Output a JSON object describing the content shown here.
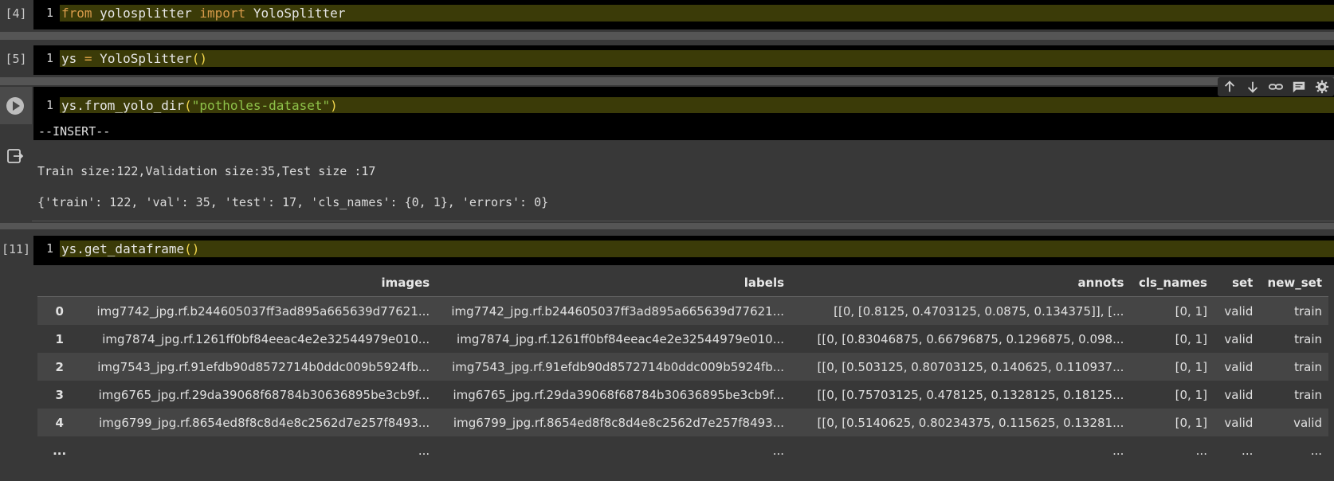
{
  "cells": {
    "c4": {
      "prompt": "[4]",
      "line": "1",
      "kw1": "from",
      "mod": " yolosplitter ",
      "kw2": "import",
      "cls": " YoloSplitter"
    },
    "c5": {
      "prompt": "[5]",
      "line": "1",
      "var": "ys ",
      "eq": "=",
      "call": " YoloSplitter",
      "paren": "()"
    },
    "c6": {
      "line": "1",
      "obj": "ys.from_yolo_dir",
      "open": "(",
      "arg": "\"potholes-dataset\"",
      "close": ")",
      "mode": "--INSERT--",
      "out1": "Train size:122,Validation size:35,Test size :17",
      "out2": "{'train': 122, 'val': 35, 'test': 17, 'cls_names': {0, 1}, 'errors': 0}"
    },
    "c11": {
      "prompt": "[11]",
      "line": "1",
      "obj": "ys.get_dataframe",
      "paren": "()"
    }
  },
  "toolbar": [
    "arrow-up-icon",
    "arrow-down-icon",
    "link-icon",
    "comment-icon",
    "gear-icon"
  ],
  "table": {
    "headers": [
      "",
      "images",
      "labels",
      "annots",
      "cls_names",
      "set",
      "new_set"
    ],
    "rows": [
      [
        "0",
        "img7742_jpg.rf.b244605037ff3ad895a665639d77621...",
        "img7742_jpg.rf.b244605037ff3ad895a665639d77621...",
        "[[0, [0.8125, 0.4703125, 0.0875, 0.134375]], [...",
        "[0, 1]",
        "valid",
        "train"
      ],
      [
        "1",
        "img7874_jpg.rf.1261ff0bf84eeac4e2e32544979e010...",
        "img7874_jpg.rf.1261ff0bf84eeac4e2e32544979e010...",
        "[[0, [0.83046875, 0.66796875, 0.1296875, 0.098...",
        "[0, 1]",
        "valid",
        "train"
      ],
      [
        "2",
        "img7543_jpg.rf.91efdb90d8572714b0ddc009b5924fb...",
        "img7543_jpg.rf.91efdb90d8572714b0ddc009b5924fb...",
        "[[0, [0.503125, 0.80703125, 0.140625, 0.110937...",
        "[0, 1]",
        "valid",
        "train"
      ],
      [
        "3",
        "img6765_jpg.rf.29da39068f68784b30636895be3cb9f...",
        "img6765_jpg.rf.29da39068f68784b30636895be3cb9f...",
        "[[0, [0.75703125, 0.478125, 0.1328125, 0.18125...",
        "[0, 1]",
        "valid",
        "train"
      ],
      [
        "4",
        "img6799_jpg.rf.8654ed8f8c8d4e8c2562d7e257f8493...",
        "img6799_jpg.rf.8654ed8f8c8d4e8c2562d7e257f8493...",
        "[[0, [0.5140625, 0.80234375, 0.115625, 0.13281...",
        "[0, 1]",
        "valid",
        "valid"
      ],
      [
        "...",
        "...",
        "...",
        "...",
        "...",
        "...",
        "..."
      ]
    ]
  }
}
